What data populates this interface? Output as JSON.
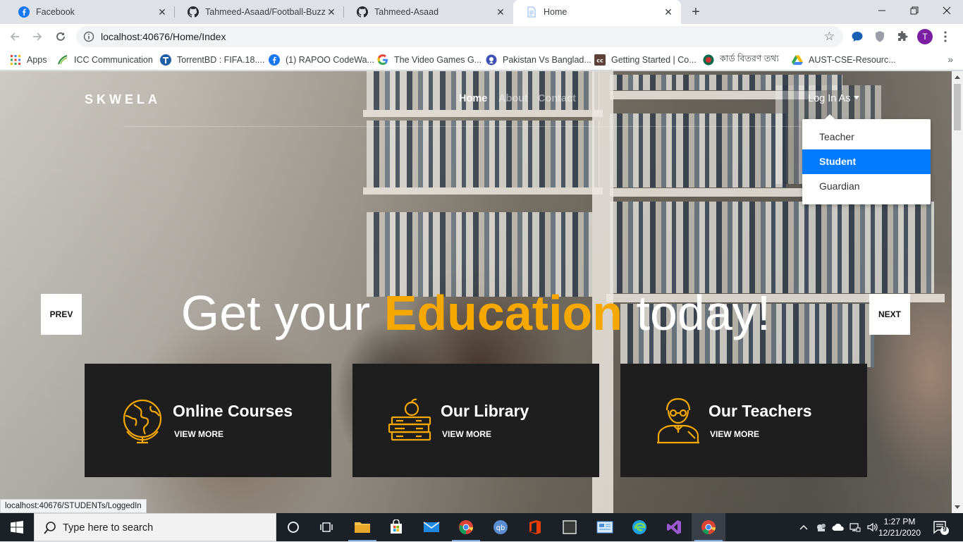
{
  "browser": {
    "tabs": [
      {
        "title": "Facebook",
        "icon": "facebook-icon",
        "active": false
      },
      {
        "title": "Tahmeed-Asaad/Football-Buzz: T",
        "icon": "github-icon",
        "active": false
      },
      {
        "title": "Tahmeed-Asaad",
        "icon": "github-icon",
        "active": false
      },
      {
        "title": "Home",
        "icon": "document-icon",
        "active": true
      }
    ],
    "url": "localhost:40676/Home/Index",
    "profile_initial": "T",
    "bookmarks": [
      {
        "label": "Apps",
        "icon": "apps-grid-icon"
      },
      {
        "label": "ICC Communication",
        "icon": "icc-logo-icon"
      },
      {
        "label": "TorrentBD : FIFA.18....",
        "icon": "torrentbd-icon"
      },
      {
        "label": "(1) RAPOO CodeWa...",
        "icon": "facebook-icon"
      },
      {
        "label": "The Video Games G...",
        "icon": "google-icon"
      },
      {
        "label": "Pakistan Vs Banglad...",
        "icon": "cricket-icon"
      },
      {
        "label": "Getting Started | Co...",
        "icon": "cc-icon"
      },
      {
        "label": "কার্ড বিতরণ তথ্য",
        "icon": "bd-emblem-icon"
      },
      {
        "label": "AUST-CSE-Resourc...",
        "icon": "google-drive-icon"
      }
    ],
    "status_url": "localhost:40676/STUDENTs/LoggedIn"
  },
  "site": {
    "brand": "SKWELA",
    "nav": [
      {
        "label": "Home",
        "active": true
      },
      {
        "label": "About",
        "active": false
      },
      {
        "label": "Contact",
        "active": false
      }
    ],
    "login_label": "Log In As",
    "login_menu": [
      {
        "label": "Teacher",
        "selected": false
      },
      {
        "label": "Student",
        "selected": true
      },
      {
        "label": "Guardian",
        "selected": false
      }
    ],
    "hero": {
      "before": "Get your ",
      "highlight": "Education",
      "after": " today!"
    },
    "prev_label": "PREV",
    "next_label": "NEXT",
    "cards": [
      {
        "title": "Online Courses",
        "more": "VIEW MORE",
        "icon": "globe-icon"
      },
      {
        "title": "Our Library",
        "more": "VIEW MORE",
        "icon": "books-apple-icon"
      },
      {
        "title": "Our Teachers",
        "more": "VIEW MORE",
        "icon": "teacher-icon"
      }
    ],
    "accent_color": "#f7a800",
    "dropdown_selected_color": "#007bff"
  },
  "taskbar": {
    "search_placeholder": "Type here to search",
    "time": "1:27 PM",
    "date": "12/21/2020",
    "notification_count": "9"
  }
}
